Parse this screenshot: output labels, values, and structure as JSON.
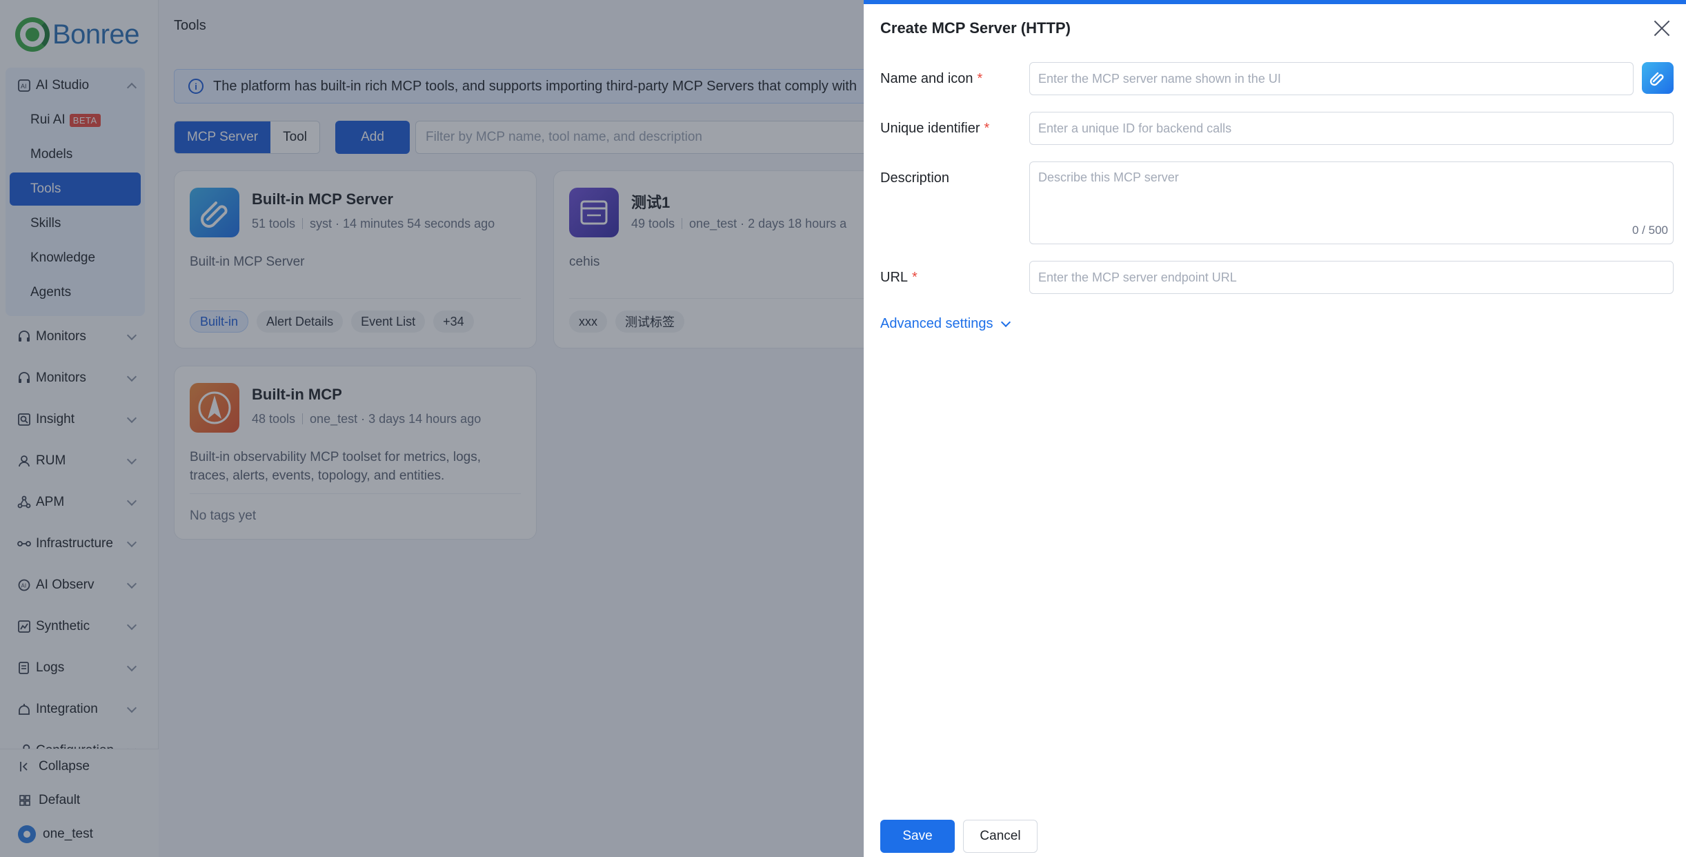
{
  "brand": {
    "logo_text": "Bonree"
  },
  "sidebar": {
    "open_group": {
      "label": "AI Studio",
      "items": [
        {
          "label": "Rui AI",
          "badge": "BETA"
        },
        {
          "label": "Models"
        },
        {
          "label": "Tools",
          "active": true
        },
        {
          "label": "Skills"
        },
        {
          "label": "Knowledge"
        },
        {
          "label": "Agents"
        }
      ]
    },
    "groups": [
      {
        "label": "Monitors",
        "icon": "headset-icon"
      },
      {
        "label": "Monitors",
        "icon": "headset-icon"
      },
      {
        "label": "Insight",
        "icon": "magnifier-icon"
      },
      {
        "label": "RUM",
        "icon": "user-icon"
      },
      {
        "label": "APM",
        "icon": "network-icon"
      },
      {
        "label": "Infrastructure",
        "icon": "nodes-icon"
      },
      {
        "label": "AI Observ",
        "icon": "ai-eye-icon"
      },
      {
        "label": "Synthetic",
        "icon": "chart-icon"
      },
      {
        "label": "Logs",
        "icon": "log-icon"
      },
      {
        "label": "Integration",
        "icon": "plug-icon"
      },
      {
        "label": "Configuration",
        "icon": "wrench-icon"
      }
    ],
    "bottom": {
      "collapse": "Collapse",
      "workspace": "Default",
      "user": "one_test"
    }
  },
  "main": {
    "title": "Tools",
    "info": "The platform has built-in rich MCP tools, and supports importing third-party MCP Servers that comply with",
    "tabs": [
      "MCP Server",
      "Tool"
    ],
    "add_label": "Add",
    "filter_placeholder": "Filter by MCP name, tool name, and description",
    "cards": [
      {
        "title": "Built-in MCP Server",
        "tools": "51 tools",
        "meta": "syst · 14 minutes 54 seconds ago",
        "desc": "Built-in MCP Server",
        "tags": [
          "Built-in",
          "Alert Details",
          "Event List",
          "+34"
        ]
      },
      {
        "title": "测试1",
        "tools": "49 tools",
        "meta": "one_test · 2 days 18 hours a",
        "desc": "cehis",
        "tags": [
          "xxx",
          "测试标签"
        ]
      },
      {
        "title": "Built-in MCP",
        "tools": "48 tools",
        "meta": "one_test · 3 days 14 hours ago",
        "desc_line1": "Built-in observability MCP toolset for metrics, logs,",
        "desc_line2": "traces, alerts, events, topology, and entities.",
        "no_tags": "No tags yet"
      }
    ]
  },
  "drawer": {
    "title": "Create MCP Server (HTTP)",
    "fields": {
      "name_label": "Name and icon",
      "name_placeholder": "Enter the MCP server name shown in the UI",
      "id_label": "Unique identifier",
      "id_placeholder": "Enter a unique ID for backend calls",
      "desc_label": "Description",
      "desc_placeholder": "Describe this MCP server",
      "desc_counter": "0 / 500",
      "url_label": "URL",
      "url_placeholder": "Enter the MCP server endpoint URL",
      "required_mark": "*"
    },
    "advanced": "Advanced settings",
    "save": "Save",
    "cancel": "Cancel"
  },
  "colors": {
    "primary": "#1d6fe8",
    "active_nav": "#1d5bd8",
    "required": "#e8483d"
  }
}
